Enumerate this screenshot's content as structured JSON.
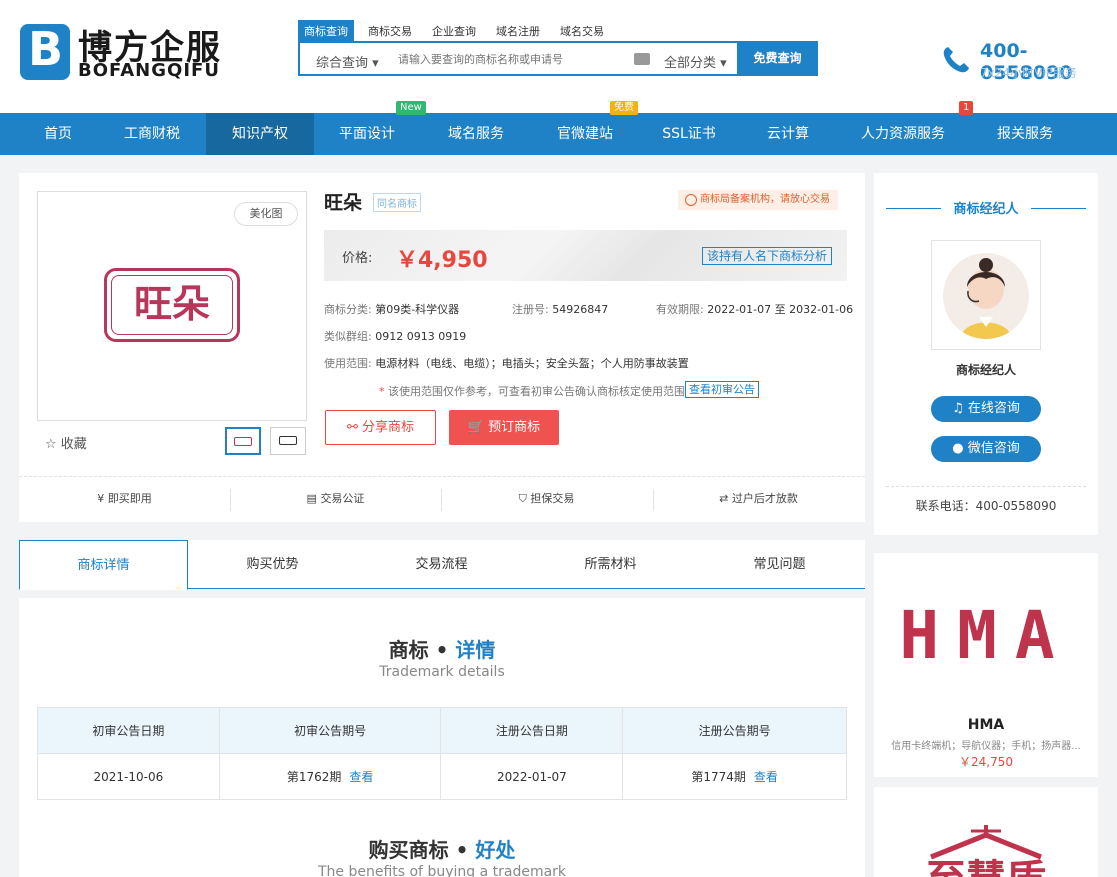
{
  "brand": {
    "logo_letter": "B",
    "name_cn": "博方企服",
    "name_en": "BOFANGQIFU"
  },
  "search": {
    "tabs": [
      "商标查询",
      "商标交易",
      "企业查询",
      "域名注册",
      "域名交易"
    ],
    "type_label": "综合查询 ▾",
    "placeholder": "请输入要查询的商标名称或申请号",
    "category_label": "全部分类 ▾",
    "button_label": "免费查询"
  },
  "hotline": {
    "number": "400-0558090",
    "sub": "7x24小时VIP服务"
  },
  "nav": {
    "items": [
      "首页",
      "工商财税",
      "知识产权",
      "平面设计",
      "域名服务",
      "官微建站",
      "SSL证书",
      "云计算",
      "人力资源服务",
      "报关服务"
    ],
    "badge_new": "New",
    "badge_free": "免费",
    "badge_count": "1"
  },
  "trademark": {
    "beautify_label": "美化图",
    "logo_text": "旺朵",
    "favorite_label": "☆ 收藏",
    "name": "旺朵",
    "same_name_tag": "同名商标",
    "notice": "商标局备案机构，请放心交易",
    "price_label": "价格:",
    "price": "￥4,950",
    "analysis_link": "该持有人名下商标分析",
    "class_key": "商标分类:",
    "class_val": "第09类-科学仪器",
    "reg_key": "注册号:",
    "reg_val": "54926847",
    "valid_key": "有效期限:",
    "valid_val": "2022-01-07 至 2032-01-06",
    "group_key": "类似群组:",
    "group_val": "0912 0913 0919",
    "scope_key": "使用范围:",
    "scope_val": "电源材料（电线、电缆）；电插头；安全头盔；个人用防事故装置",
    "scope_note_star": "*",
    "scope_note": "该使用范围仅作参考，可查看初审公告确认商标核定使用范围",
    "announce_link": "查看初审公告",
    "share_label": "分享商标",
    "order_label": "预订商标"
  },
  "features": [
    "即买即用",
    "交易公证",
    "担保交易",
    "过户后才放款"
  ],
  "agent": {
    "title": "商标经纪人",
    "name": "商标经纪人",
    "online_btn": "在线咨询",
    "wechat_btn": "微信咨询",
    "phone": "联系电话：400-0558090"
  },
  "tabs": [
    "商标详情",
    "购买优势",
    "交易流程",
    "所需材料",
    "常见问题"
  ],
  "details": {
    "title_main": "商标 • ",
    "title_hl": "详情",
    "subtitle": "Trademark details",
    "headers": [
      "初审公告日期",
      "初审公告期号",
      "注册公告日期",
      "注册公告期号"
    ],
    "row": {
      "prelim_date": "2021-10-06",
      "prelim_issue": "第1762期",
      "reg_date": "2022-01-07",
      "reg_issue": "第1774期",
      "view": "查看"
    }
  },
  "benefits": {
    "title_main": "购买商标 • ",
    "title_hl": "好处",
    "subtitle": "The benefits of buying a trademark"
  },
  "recommend": [
    {
      "logo": "HMA",
      "name": "HMA",
      "desc": "信用卡终端机；导航仪器；手机；扬声器...",
      "price": "￥24,750"
    },
    {
      "logo": "至慧盾"
    }
  ],
  "colors": {
    "primary": "#1f82c6",
    "price": "#e8473f",
    "logo": "#b8365a"
  }
}
